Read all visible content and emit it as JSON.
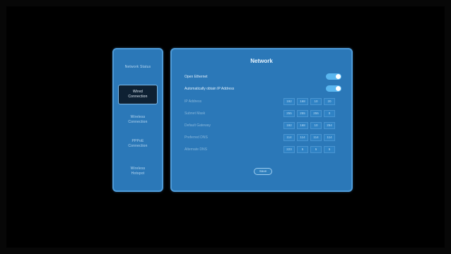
{
  "sidebar": {
    "items": [
      {
        "label_lines": [
          "Network Status"
        ]
      },
      {
        "label_lines": [
          "Wired",
          "Connection"
        ]
      },
      {
        "label_lines": [
          "Wireless",
          "Connection"
        ]
      },
      {
        "label_lines": [
          "PPPoE",
          "Connection"
        ]
      },
      {
        "label_lines": [
          "Wireless",
          "Hotspot"
        ]
      }
    ]
  },
  "main": {
    "title": "Network",
    "toggles": [
      {
        "label": "Open Ethernet",
        "on": true
      },
      {
        "label": "Automatically obtain IP Address",
        "on": true
      }
    ],
    "fields": [
      {
        "label": "IP Address",
        "octets": [
          "192",
          "168",
          "10",
          "20"
        ]
      },
      {
        "label": "Subnet Mask",
        "octets": [
          "255",
          "255",
          "255",
          "0"
        ]
      },
      {
        "label": "Default Gateway",
        "octets": [
          "192",
          "168",
          "10",
          "254"
        ]
      },
      {
        "label": "Preferred DNS",
        "octets": [
          "114",
          "114",
          "114",
          "114"
        ]
      },
      {
        "label": "Alternate DNS",
        "octets": [
          "223",
          "5",
          "5",
          "5"
        ]
      }
    ],
    "save_label": "Save"
  },
  "colors": {
    "panel": "#2b78b8",
    "panel_border": "#4e9bd8",
    "active_item_bg": "#0e2133",
    "toggle_on": "#5ab6ef",
    "background": "#000000"
  }
}
